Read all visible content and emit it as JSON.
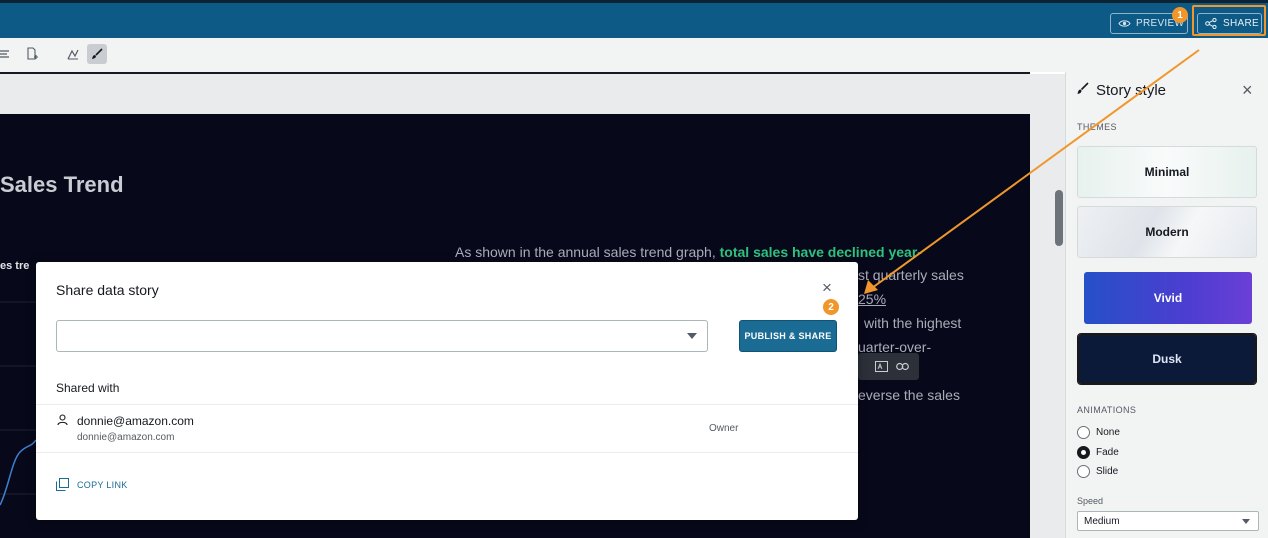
{
  "topbar": {
    "preview_label": "PREVIEW",
    "share_label": "SHARE",
    "step_one": "1",
    "step_two": "2"
  },
  "toolbar": {
    "tools": [
      "align-icon",
      "add-block-icon",
      "chart-style-icon",
      "brush-icon"
    ]
  },
  "slide": {
    "title": "Sales Trend",
    "chart_label": "es tre",
    "body_prefix": "As shown in the annual sales trend graph, ",
    "body_highlight": "total sales have declined year-",
    "line2": "st quarterly sales",
    "line3": "25%",
    "line4": "with the highest",
    "line5": "uarter-over-",
    "line6": "everse the sales"
  },
  "panel": {
    "title": "Story style",
    "themes_label": "THEMES",
    "themes": [
      {
        "name": "Minimal"
      },
      {
        "name": "Modern"
      },
      {
        "name": "Vivid"
      },
      {
        "name": "Dusk",
        "selected": true
      }
    ],
    "animations_label": "ANIMATIONS",
    "animations": [
      {
        "label": "None",
        "checked": false
      },
      {
        "label": "Fade",
        "checked": true
      },
      {
        "label": "Slide",
        "checked": false
      }
    ],
    "speed_label": "Speed",
    "speed_value": "Medium"
  },
  "modal": {
    "title": "Share data story",
    "input_value": "",
    "publish_label": "PUBLISH & SHARE",
    "shared_with_label": "Shared with",
    "user": {
      "name": "donnie@amazon.com",
      "email": "donnie@amazon.com",
      "role": "Owner"
    },
    "copy_link_label": "COPY LINK"
  },
  "colors": {
    "topbar": "#0d5a86",
    "annotation": "#f0962a",
    "highlight_text": "#2ec27e",
    "publish_button": "#1a6c94",
    "slide_bg": "#07091a"
  }
}
